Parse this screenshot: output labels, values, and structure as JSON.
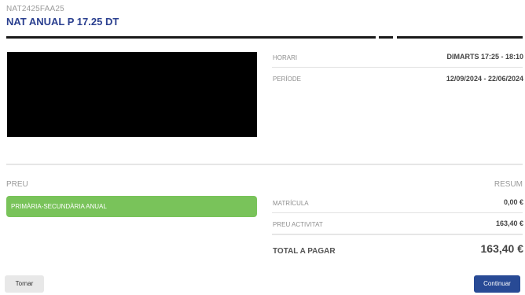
{
  "header": {
    "code": "NAT2425FAA25",
    "title": "NAT ANUAL P 17.25 DT"
  },
  "schedule": {
    "horari_label": "HORARI",
    "horari_value": "DIMARTS 17:25 - 18:10",
    "periode_label": "PERÍODE",
    "periode_value": "12/09/2024 - 22/06/2024"
  },
  "price": {
    "section_label": "PREU",
    "summary_label": "RESUM",
    "option_label": "PRIMÀRIA-SECUNDÀRIA ANUAL",
    "matricula_label": "MATRÍCULA",
    "matricula_value": "0,00 €",
    "activitat_label": "PREU ACTIVITAT",
    "activitat_value": "163,40 €",
    "total_label": "TOTAL A PAGAR",
    "total_value": "163,40 €"
  },
  "buttons": {
    "back": "Tornar",
    "continue": "Continuar"
  },
  "colors": {
    "title": "#2a3f8f",
    "pill": "#79c35a",
    "continue_button": "#284a95"
  }
}
